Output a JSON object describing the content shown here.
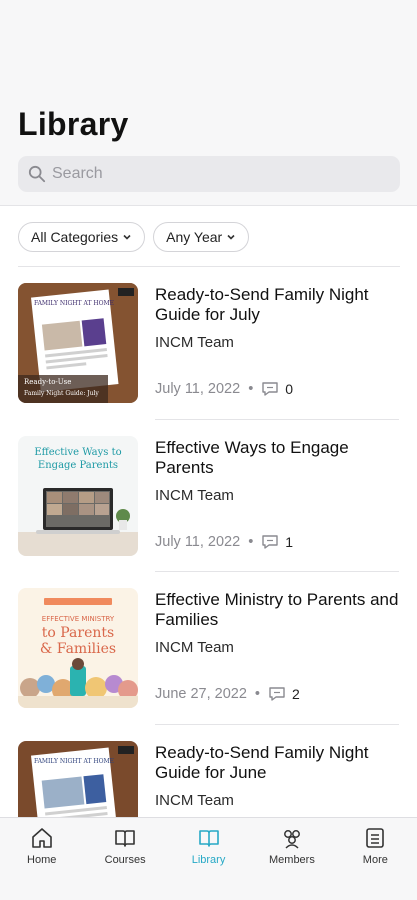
{
  "header": {
    "title": "Library"
  },
  "search": {
    "placeholder": "Search"
  },
  "filters": [
    {
      "label": "All Categories"
    },
    {
      "label": "Any Year"
    }
  ],
  "items": [
    {
      "title": "Ready-to-Send Family Night Guide for July",
      "author": "INCM Team",
      "date": "July 11, 2022",
      "comments": "0",
      "thumb": {
        "top_text": "FAMILY NIGHT AT HOME",
        "badge": "Ready-to-Use",
        "caption": "Family Night Guide: July"
      }
    },
    {
      "title": "Effective Ways to Engage Parents",
      "author": "INCM Team",
      "date": "July 11, 2022",
      "comments": "1",
      "thumb": {
        "line1": "Effective Ways to",
        "line2": "Engage Parents"
      }
    },
    {
      "title": "Effective Ministry to Parents and Families",
      "author": "INCM Team",
      "date": "June 27, 2022",
      "comments": "2",
      "thumb": {
        "line1": "EFFECTIVE MINISTRY",
        "line2": "to Parents",
        "line3": "& Families"
      }
    },
    {
      "title": "Ready-to-Send Family Night Guide for June",
      "author": "INCM Team",
      "date": "",
      "comments": "",
      "thumb": {
        "top_text": "FAMILY NIGHT AT HOME"
      }
    }
  ],
  "tabbar": {
    "tabs": [
      {
        "label": "Home",
        "icon": "home-icon"
      },
      {
        "label": "Courses",
        "icon": "courses-icon"
      },
      {
        "label": "Library",
        "icon": "library-icon",
        "active": true
      },
      {
        "label": "Members",
        "icon": "members-icon"
      },
      {
        "label": "More",
        "icon": "more-icon"
      }
    ],
    "active_color": "#27a9c6"
  }
}
